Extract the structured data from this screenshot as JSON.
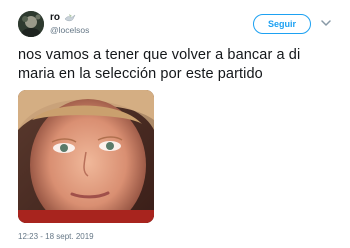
{
  "author": {
    "display_name": "ro",
    "handle": "@locelsos",
    "name_emoji": "dove-emoji"
  },
  "follow_button": {
    "label": "Seguir"
  },
  "menu_icon": "chevron-down-icon",
  "tweet": {
    "text_line_1": "nos vamos a tener que volver a bancar a di",
    "text_line_2": "maria en la selección por este partido",
    "timestamp": "12:23 - 18 sept. 2019"
  },
  "colors": {
    "accent": "#1da1f2",
    "text": "#14171a",
    "secondary_text": "#657786"
  }
}
